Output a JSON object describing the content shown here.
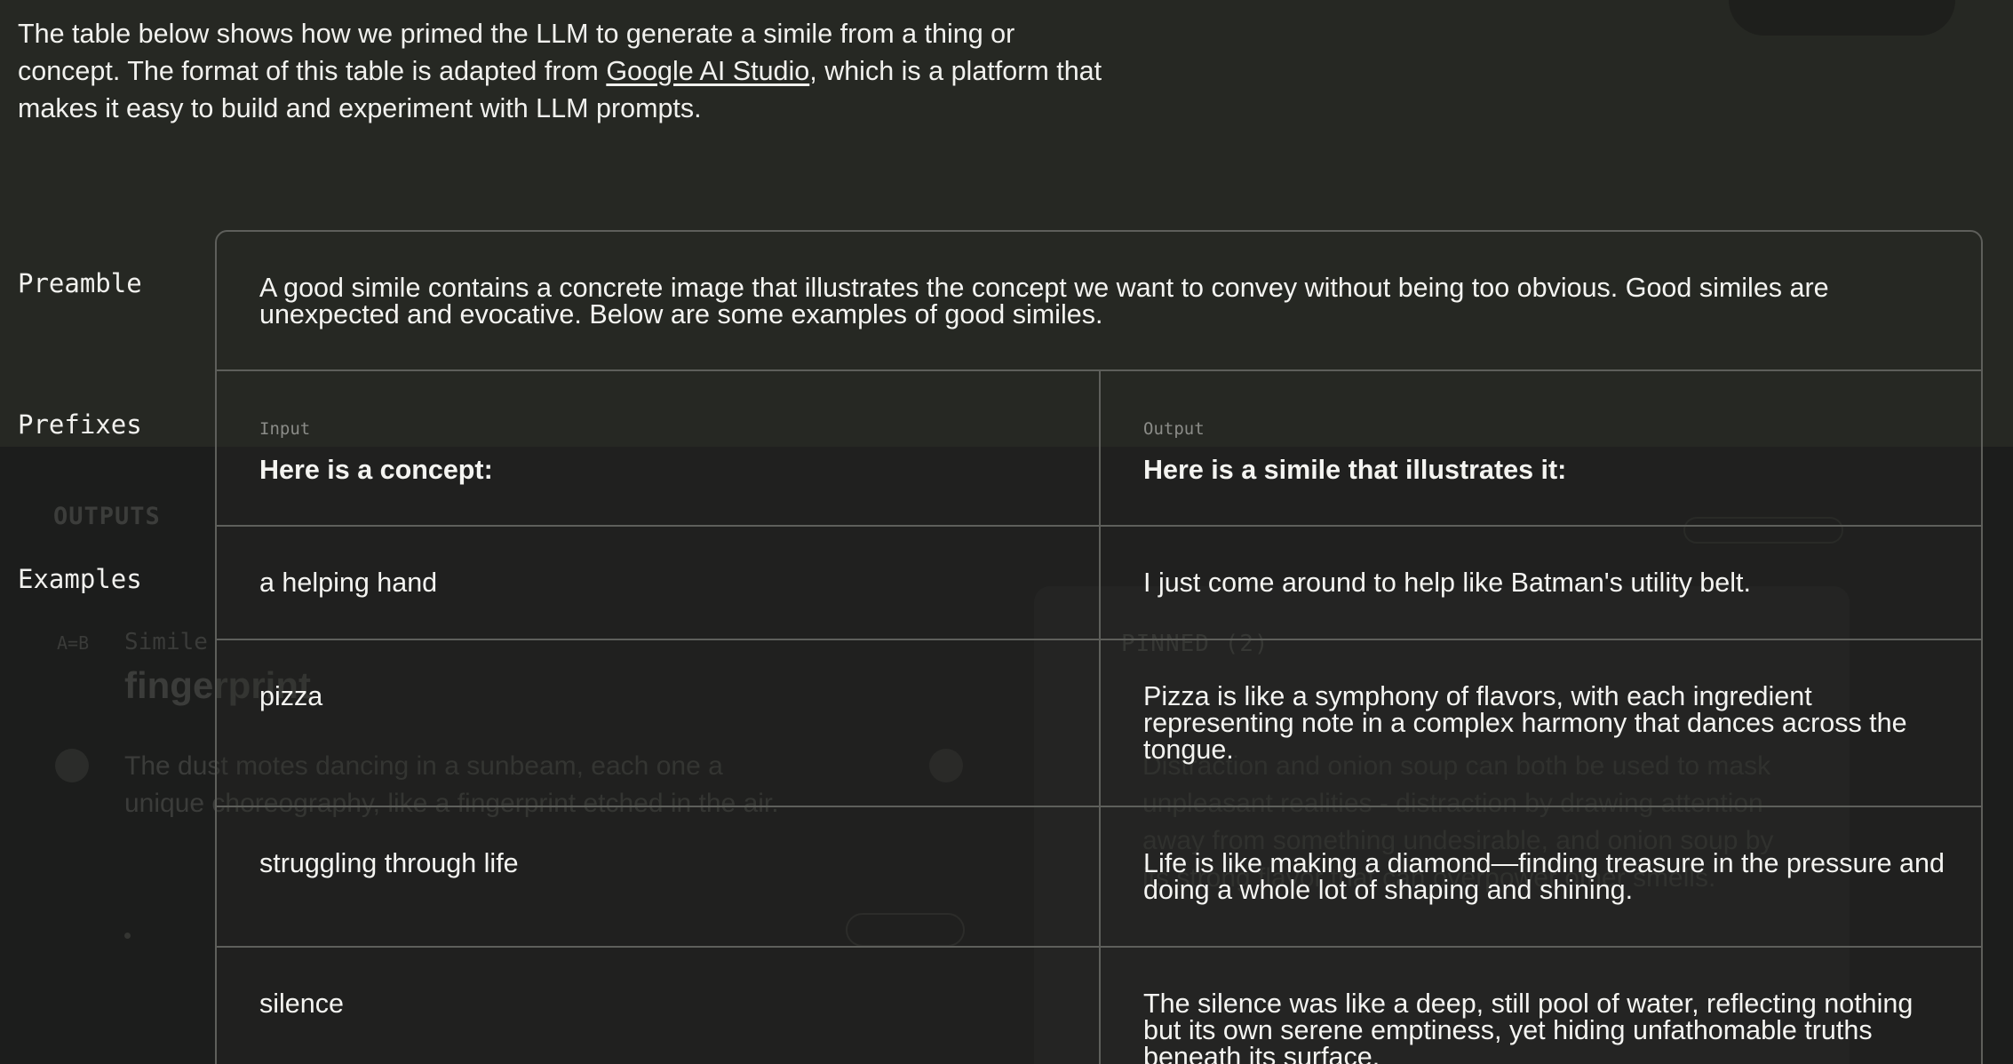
{
  "intro": {
    "before": "The table below shows how we primed the LLM to generate a simile from a thing or concept. The format of this table is adapted from ",
    "link": "Google AI Studio",
    "after": ", which is a platform that makes it easy to build and experiment with LLM prompts."
  },
  "labels": {
    "preamble": "Preamble",
    "prefixes": "Prefixes",
    "examples": "Examples"
  },
  "preamble": "A good simile contains a concrete image that illustrates the concept we want to convey without being too obvious. Good similes are unexpected and evocative. Below are some examples of good similes.",
  "prefixes": {
    "input_label": "Input",
    "input_text": "Here is a concept:",
    "output_label": "Output",
    "output_text": "Here is a simile that illustrates it:"
  },
  "examples": [
    {
      "input": "a helping hand",
      "output": "I just come around to help like Batman's utility belt."
    },
    {
      "input": "pizza",
      "output": "Pizza is like a symphony of flavors, with each ingredient representing note in a complex harmony that dances across the tongue."
    },
    {
      "input": "struggling through life",
      "output": "Life is like making a diamond—finding treasure in the pressure and doing a whole lot of shaping and shining."
    },
    {
      "input": "silence",
      "output": "The silence was like a deep, still pool of water, reflecting nothing but its own serene emptiness, yet hiding unfathomable truths beneath its surface."
    }
  ],
  "background": {
    "outputs": "OUTPUTS",
    "ab": "A=B",
    "simile": "Simile",
    "concept": "fingerprint",
    "output_text": "The dust motes dancing in a sunbeam, each one a unique choreography, like a fingerprint etched in the air.",
    "pinned": "PINNED (2)",
    "pinned_text": "Distraction and onion soup can both be used to mask unpleasant realities - distraction by drawing attention away from something undesirable, and onion soup by its strong flavor that can overpower other smells."
  }
}
